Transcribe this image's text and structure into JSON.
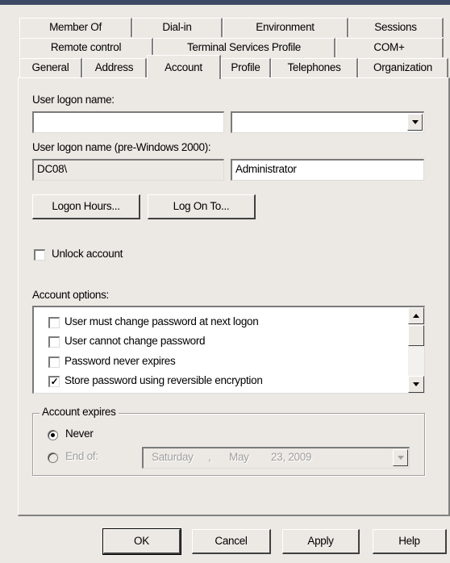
{
  "tabs": {
    "row1": [
      "Member Of",
      "Dial-in",
      "Environment",
      "Sessions"
    ],
    "row2": [
      "Remote control",
      "Terminal Services Profile",
      "COM+"
    ],
    "row3": [
      "General",
      "Address",
      "Account",
      "Profile",
      "Telephones",
      "Organization"
    ],
    "active": "Account"
  },
  "account": {
    "logon_name_label": "User logon name:",
    "logon_name_value": "",
    "domain_suffix_value": "",
    "pre2000_label": "User logon name (pre-Windows 2000):",
    "pre2000_domain": "DC08\\",
    "pre2000_user": "Administrator",
    "logon_hours_button": "Logon Hours...",
    "log_on_to_button": "Log On To...",
    "unlock_label": "Unlock account",
    "unlock_checked": false,
    "options_label": "Account options:",
    "options": [
      {
        "label": "User must change password at next logon",
        "checked": false
      },
      {
        "label": "User cannot change password",
        "checked": false
      },
      {
        "label": "Password never expires",
        "checked": false
      },
      {
        "label": "Store password using reversible encryption",
        "checked": true
      }
    ],
    "expires_group": "Account expires",
    "never_label": "Never",
    "never_selected": true,
    "end_of_label": "End of:",
    "end_of_weekday": "Saturday",
    "end_of_sep": ",",
    "end_of_month": "May",
    "end_of_daydate": "23, 2009"
  },
  "footer": {
    "ok": "OK",
    "cancel": "Cancel",
    "apply": "Apply",
    "help": "Help"
  }
}
